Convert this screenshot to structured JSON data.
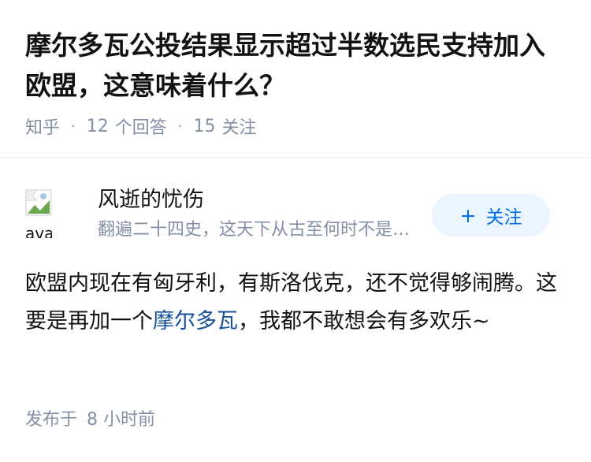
{
  "question": {
    "title": "摩尔多瓦公投结果显示超过半数选民支持加入欧盟，这意味着什么？",
    "source": "知乎",
    "answer_count": "12",
    "answer_label": "个回答",
    "follower_count": "15",
    "follower_label": "关注"
  },
  "author": {
    "avatar_alt": "avatar",
    "avatar_icon": "broken-image-icon",
    "name": "风逝的忧伤",
    "bio": "翻遍二十四史，这天下从古至何时不是这样",
    "follow_label": "关注",
    "follow_icon": "plus-icon"
  },
  "answer": {
    "text_before": "欧盟内现在有匈牙利，有斯洛伐克，还不觉得够闹腾。这要是再加一个",
    "link_text": "摩尔多瓦",
    "text_after": "，我都不敢想会有多欢乐~",
    "published_label": "发布于",
    "published_time": "8 小时前"
  },
  "colors": {
    "title": "#121212",
    "meta": "#8590a6",
    "link": "#175199",
    "follow_bg": "#ebf5ff",
    "follow_text": "#056de8"
  }
}
